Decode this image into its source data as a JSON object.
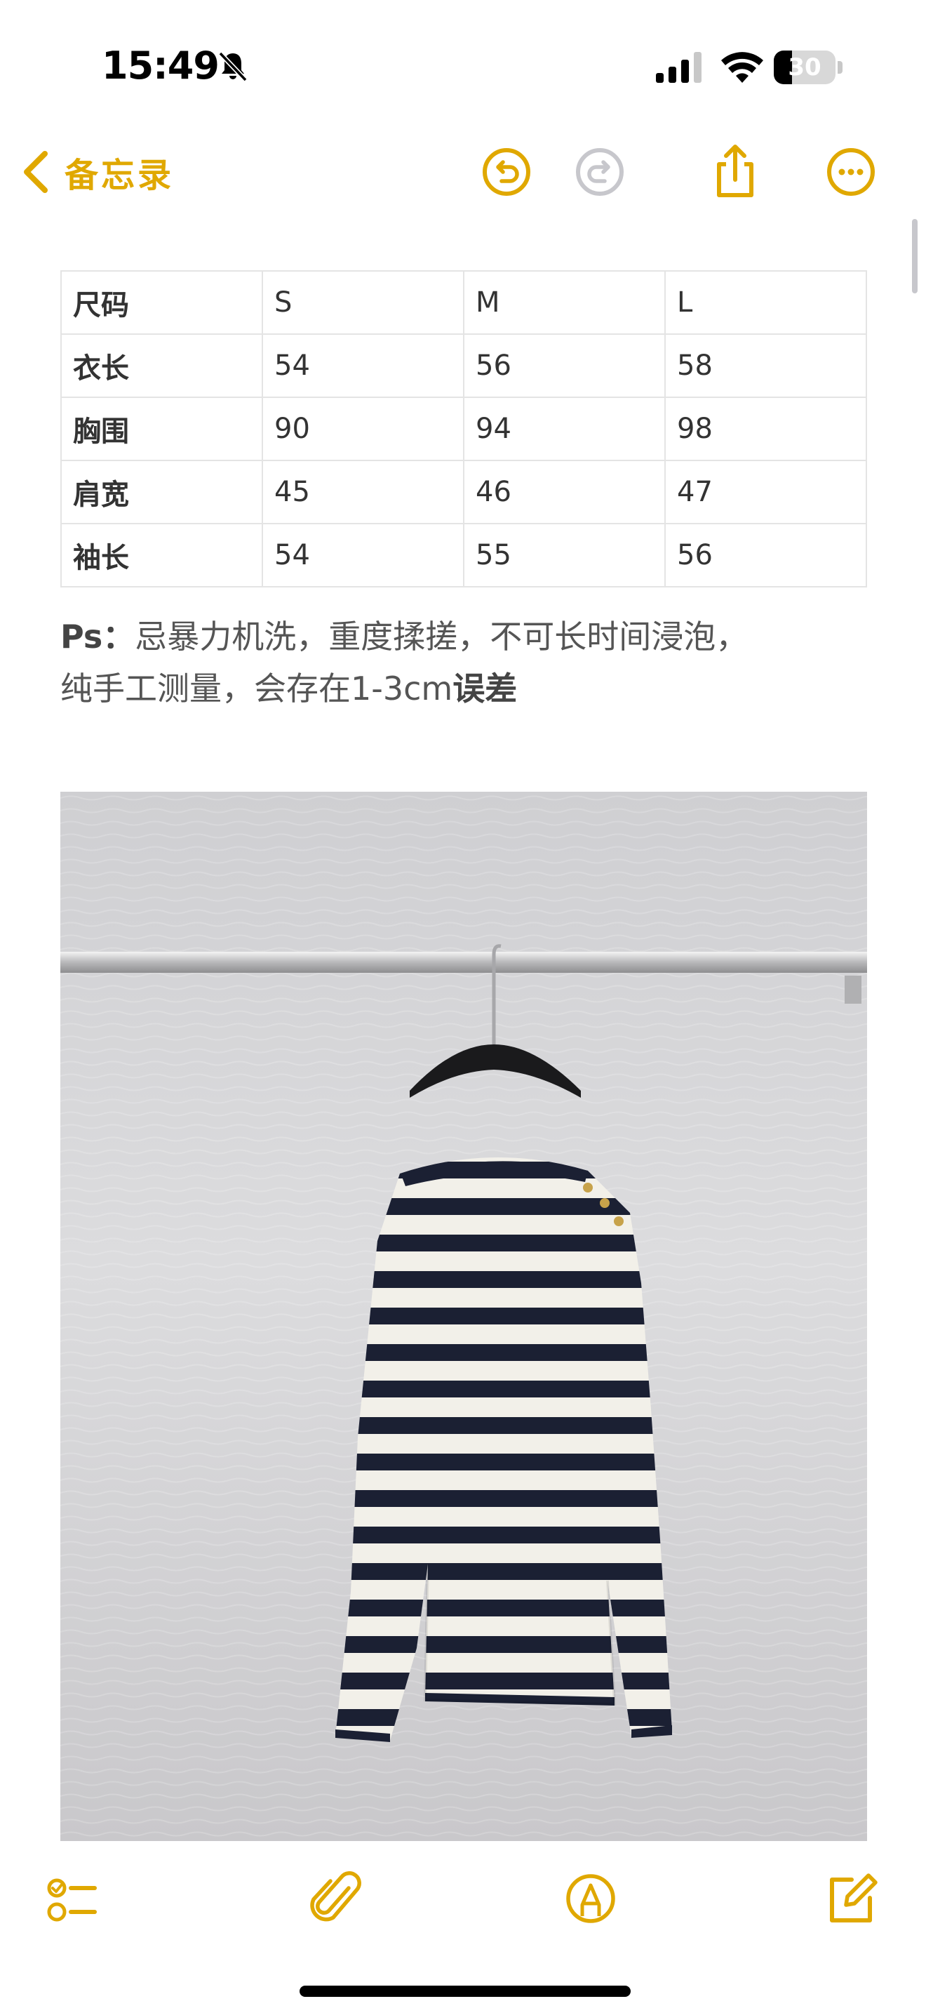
{
  "status_bar": {
    "time": "15:49",
    "battery_level": "30",
    "icons": [
      "bell-slash-icon",
      "cellular-signal-icon",
      "wifi-icon",
      "battery-icon"
    ]
  },
  "nav": {
    "back_label": "备忘录",
    "icons": [
      "chevron-left-icon",
      "undo-icon",
      "redo-icon",
      "share-icon",
      "more-icon"
    ],
    "accent_color": "#e0a800",
    "disabled_color": "#c7c7cc"
  },
  "size_table": {
    "rows": [
      [
        "尺码",
        "S",
        "M",
        "L"
      ],
      [
        "衣长",
        "54",
        "56",
        "58"
      ],
      [
        "胸围",
        "90",
        "94",
        "98"
      ],
      [
        "肩宽",
        "45",
        "46",
        "47"
      ],
      [
        "袖长",
        "54",
        "55",
        "56"
      ]
    ]
  },
  "note": {
    "prefix": "Ps：",
    "line1": "忌暴力机洗，重度揉搓，不可长时间浸泡，",
    "line2": "纯手工测量，会存在1-3cm",
    "suffix": "误差"
  },
  "photo": {
    "subject": "striped-sweater-photo",
    "stripe_color": "#1b2033",
    "base_color": "#f2f0e9"
  },
  "toolbar": {
    "icons": [
      "checklist-icon",
      "paperclip-icon",
      "markup-icon",
      "compose-icon"
    ]
  }
}
